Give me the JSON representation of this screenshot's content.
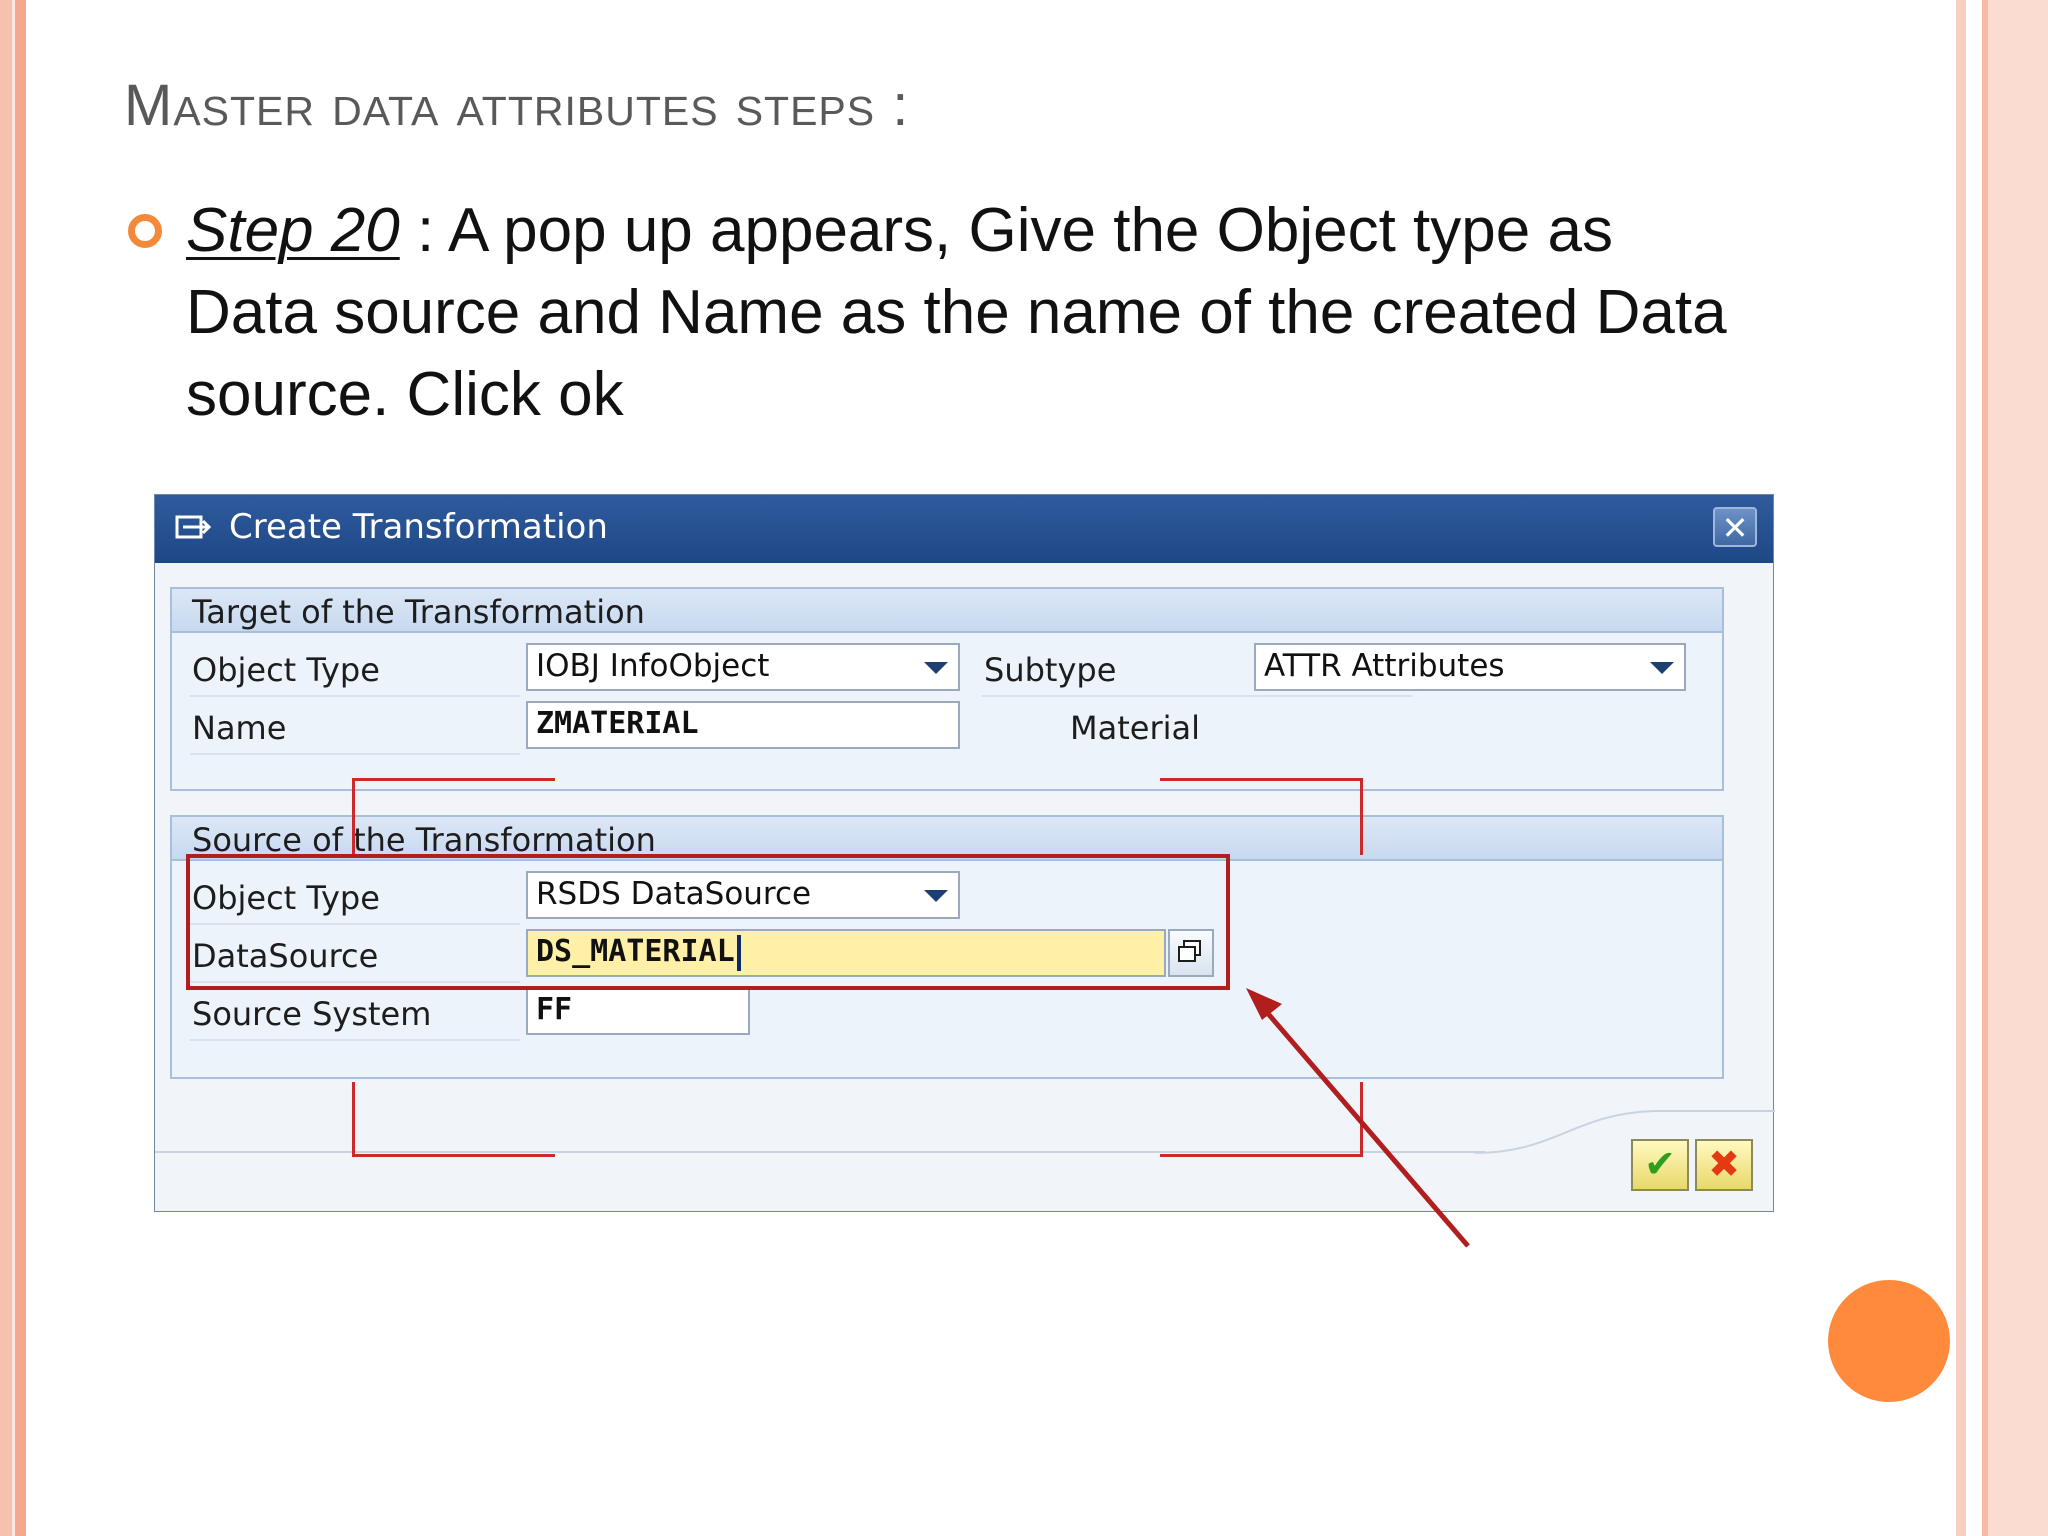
{
  "slide": {
    "title": "Master data attributes steps :",
    "step_label": "Step 20",
    "step_text": " : A pop up appears, Give the   Object type as Data source and Name as the name of the created Data source. Click ok"
  },
  "dialog": {
    "title": "Create Transformation",
    "close_label": "✕",
    "target": {
      "title": "Target of the Transformation",
      "object_type_label": "Object Type",
      "object_type_value": "IOBJ InfoObject",
      "subtype_label": "Subtype",
      "subtype_value": "ATTR Attributes",
      "name_label": "Name",
      "name_value": "ZMATERIAL",
      "name_description": "Material"
    },
    "source": {
      "title": "Source of the Transformation",
      "object_type_label": "Object Type",
      "object_type_value": "RSDS DataSource",
      "datasource_label": "DataSource",
      "datasource_value": "DS_MATERIAL",
      "source_system_label": "Source System",
      "source_system_value": "FF"
    },
    "ok_symbol": "✔",
    "cancel_symbol": "✖"
  },
  "colors": {
    "accent_orange": "#ff8a3c",
    "annotation_red": "#b01e1e",
    "titlebar_blue": "#1e4786"
  }
}
